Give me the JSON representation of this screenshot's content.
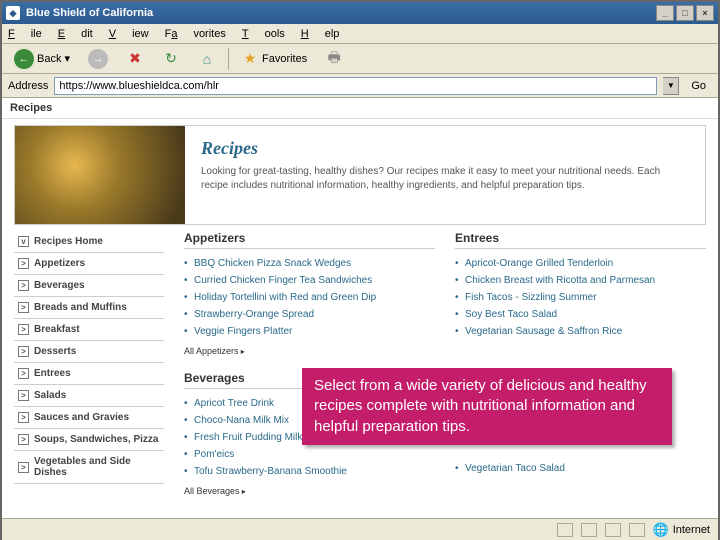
{
  "window": {
    "title": "Blue Shield of California"
  },
  "menu": {
    "file": "File",
    "edit": "Edit",
    "view": "View",
    "favorites": "Favorites",
    "tools": "Tools",
    "help": "Help"
  },
  "toolbar": {
    "back": "Back",
    "favorites": "Favorites"
  },
  "address": {
    "label": "Address",
    "url": "https://www.blueshieldca.com/hlr",
    "go": "Go"
  },
  "page": {
    "section_label": "Recipes",
    "hero_title": "Recipes",
    "hero_desc": "Looking for great-tasting, healthy dishes? Our recipes make it easy to meet your nutritional needs. Each recipe includes nutritional information, healthy ingredients, and helpful preparation tips.",
    "sidebar": [
      "Recipes Home",
      "Appetizers",
      "Beverages",
      "Breads and Muffins",
      "Breakfast",
      "Desserts",
      "Entrees",
      "Salads",
      "Sauces and Gravies",
      "Soups, Sandwiches, Pizza",
      "Vegetables and Side Dishes"
    ],
    "appetizers": {
      "heading": "Appetizers",
      "items": [
        "BBQ Chicken Pizza Snack Wedges",
        "Curried Chicken Finger Tea Sandwiches",
        "Holiday Tortellini with Red and Green Dip",
        "Strawberry-Orange Spread",
        "Veggie Fingers Platter"
      ],
      "all": "All Appetizers"
    },
    "entrees": {
      "heading": "Entrees",
      "items": [
        "Apricot-Orange Grilled Tenderloin",
        "Chicken Breast with Ricotta and Parmesan",
        "Fish Tacos - Sizzling Summer",
        "Soy Best Taco Salad",
        "Vegetarian Sausage & Saffron Rice"
      ]
    },
    "beverages": {
      "heading": "Beverages",
      "items": [
        "Apricot Tree Drink",
        "Choco-Nana Milk Mix",
        "Fresh Fruit Pudding Milk",
        "Pom'eics",
        "Tofu Strawberry-Banana Smoothie"
      ],
      "all": "All Beverages"
    },
    "entrees2": {
      "items": [
        "Vegetarian Taco Salad"
      ]
    },
    "callout": "Select from a wide variety of delicious and healthy recipes complete with nutritional information and helpful preparation tips."
  },
  "statusbar": {
    "zone": "Internet"
  }
}
